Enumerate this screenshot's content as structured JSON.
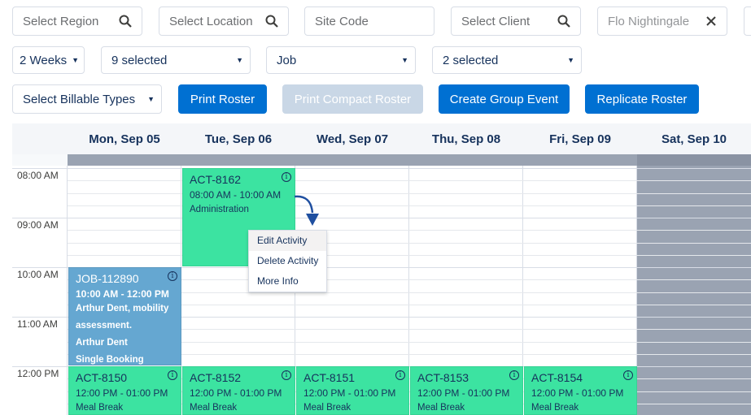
{
  "filters": {
    "region": {
      "placeholder": "Select Region",
      "icon": "search-icon"
    },
    "location": {
      "placeholder": "Select Location",
      "icon": "search-icon"
    },
    "site_code": {
      "placeholder": "Site Code"
    },
    "client": {
      "placeholder": "Select Client",
      "icon": "search-icon"
    },
    "worker": {
      "value": "Flo Nightingale",
      "icon": "close-icon"
    },
    "period": {
      "value": "2 Weeks"
    },
    "multi1": {
      "value": "9 selected"
    },
    "type": {
      "value": "Job"
    },
    "multi2": {
      "value": "2 selected"
    },
    "billable": {
      "value": "Select Billable Types"
    }
  },
  "actions": {
    "print_roster": "Print Roster",
    "print_compact": "Print Compact Roster",
    "create_group": "Create Group Event",
    "replicate": "Replicate Roster"
  },
  "calendar": {
    "days": [
      "Mon, Sep 05",
      "Tue, Sep 06",
      "Wed, Sep 07",
      "Thu, Sep 08",
      "Fri, Sep 09",
      "Sat, Sep 10"
    ],
    "times": [
      "08:00 AM",
      "09:00 AM",
      "10:00 AM",
      "11:00 AM",
      "12:00 PM"
    ],
    "events": {
      "act8162": {
        "id": "ACT-8162",
        "time": "08:00 AM - 10:00 AM",
        "desc": "Administration"
      },
      "job112890": {
        "id": "JOB-112890",
        "time": "10:00 AM - 12:00 PM",
        "desc1": "Arthur Dent, mobility",
        "desc2": "assessment.",
        "desc3": "Arthur Dent",
        "desc4": "Single Booking"
      },
      "act8150": {
        "id": "ACT-8150",
        "time": "12:00 PM - 01:00 PM",
        "desc": "Meal Break"
      },
      "act8152": {
        "id": "ACT-8152",
        "time": "12:00 PM - 01:00 PM",
        "desc": "Meal Break"
      },
      "act8151": {
        "id": "ACT-8151",
        "time": "12:00 PM - 01:00 PM",
        "desc": "Meal Break"
      },
      "act8153": {
        "id": "ACT-8153",
        "time": "12:00 PM - 01:00 PM",
        "desc": "Meal Break"
      },
      "act8154": {
        "id": "ACT-8154",
        "time": "12:00 PM - 01:00 PM",
        "desc": "Meal Break"
      }
    }
  },
  "context_menu": {
    "items": [
      "Edit Activity",
      "Delete Activity",
      "More Info"
    ]
  },
  "colors": {
    "primary": "#0070d2",
    "activity": "#3ce3a1",
    "job": "#65a7d1",
    "weekend": "#9aa3b2"
  }
}
